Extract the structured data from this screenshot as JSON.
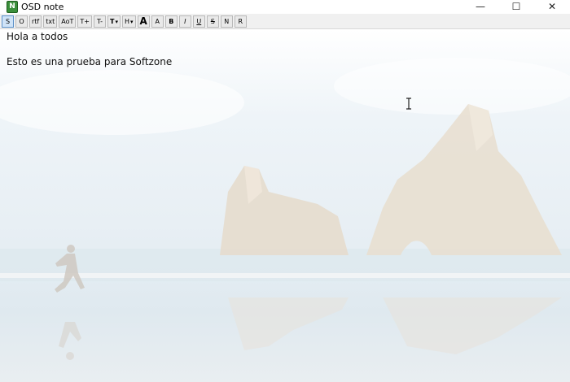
{
  "window": {
    "title": "OSD note",
    "app_icon_glyph": "N",
    "controls": {
      "minimize": "—",
      "maximize": "☐",
      "close": "✕"
    }
  },
  "toolbar": {
    "buttons": [
      "S",
      "O",
      "rtf",
      "txt",
      "AoT",
      "T+",
      "T-",
      "T",
      "H",
      "A",
      "A",
      "B",
      "I",
      "U",
      "S",
      "N",
      "R"
    ],
    "dropdown_caret": "▾"
  },
  "editor": {
    "lines": [
      "Hola a todos",
      "",
      "Esto es una prueba para Softzone"
    ]
  },
  "colors": {
    "active_button_bg": "#cfe3f7",
    "app_icon": "#3b8f3b"
  },
  "icons": {
    "app": "notepad-icon",
    "minimize": "minimize-icon",
    "maximize": "maximize-icon",
    "close": "close-icon",
    "cursor": "text-cursor-icon"
  }
}
